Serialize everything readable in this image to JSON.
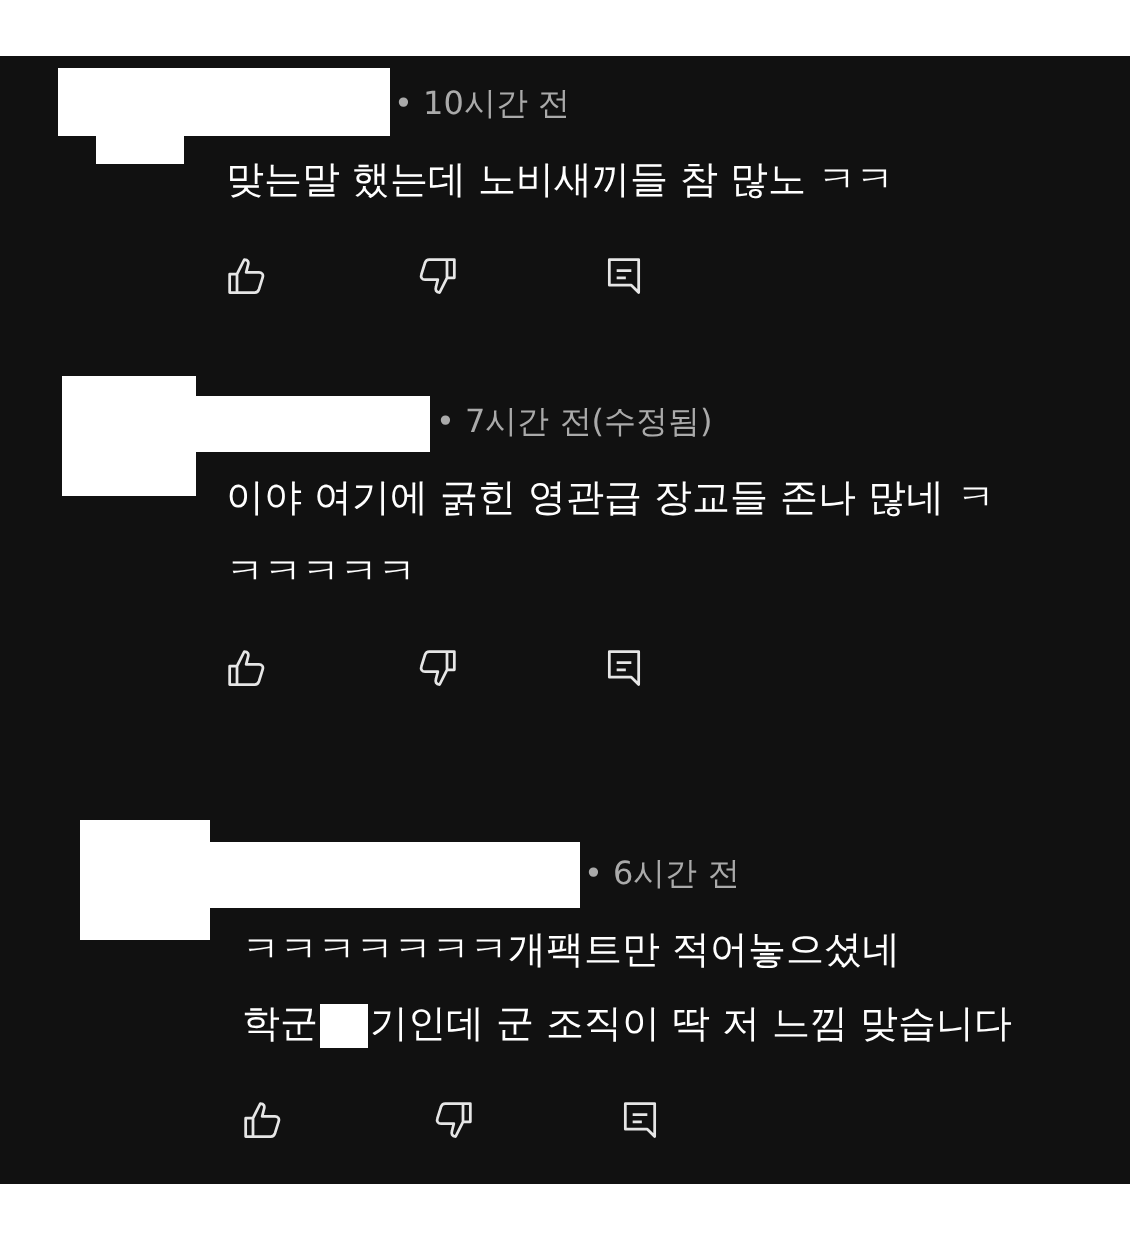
{
  "comments": [
    {
      "author_redacted": true,
      "meta": "• 10시간 전",
      "body": [
        [
          {
            "kind": "text",
            "text": "맞는말 했는데 노비새끼들 참 많노 ㅋㅋ"
          }
        ]
      ]
    },
    {
      "author_redacted": true,
      "meta": "• 7시간 전(수정됨)",
      "body": [
        [
          {
            "kind": "text",
            "text": "이야 여기에 굵힌 영관급 장교들 존나 많네 ㅋ"
          }
        ],
        [
          {
            "kind": "text",
            "text": "ㅋㅋㅋㅋㅋ"
          }
        ]
      ]
    },
    {
      "author_redacted": true,
      "meta": "• 6시간 전",
      "body": [
        [
          {
            "kind": "text",
            "text": "ㅋㅋㅋㅋㅋㅋㅋ개팩트만 적어놓으셨네"
          }
        ],
        [
          {
            "kind": "text",
            "text": "학군"
          },
          {
            "kind": "redaction"
          },
          {
            "kind": "text",
            "text": "기인데 군 조직이 딱 저 느낌 맞습니다"
          }
        ]
      ]
    }
  ]
}
